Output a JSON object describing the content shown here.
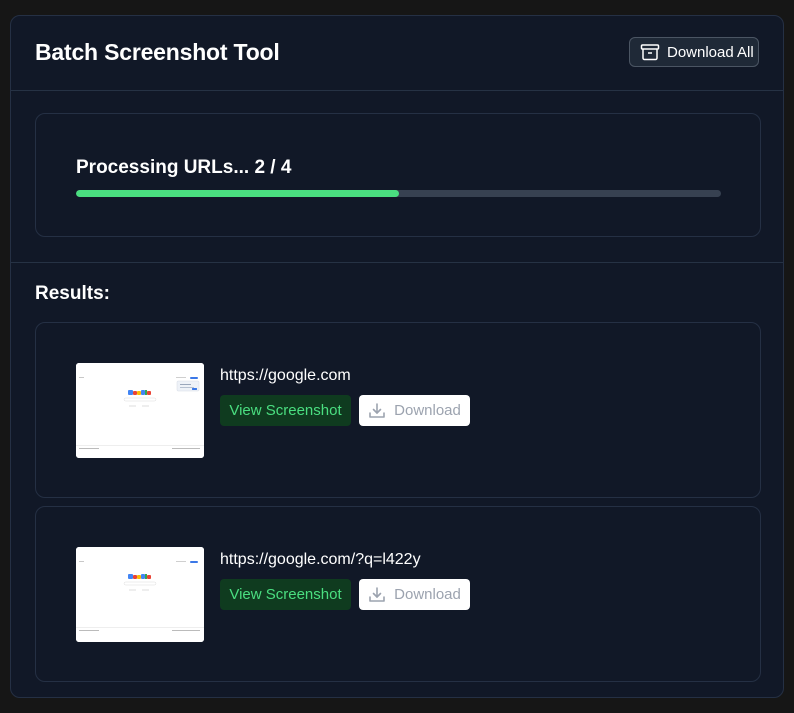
{
  "header": {
    "title": "Batch Screenshot Tool",
    "download_all_label": "Download All",
    "download_all_icon": "archive-icon"
  },
  "progress": {
    "label": "Processing URLs... 2 / 4",
    "completed": 2,
    "total": 4,
    "fraction": 0.5
  },
  "results": {
    "label": "Results:",
    "items": [
      {
        "url": "https://google.com",
        "view_label": "View Screenshot",
        "download_label": "Download",
        "download_icon": "download-icon"
      },
      {
        "url": "https://google.com/?q=l422y",
        "view_label": "View Screenshot",
        "download_label": "Download",
        "download_icon": "download-icon"
      }
    ]
  },
  "colors": {
    "background": "#111827",
    "progress_fill": "#4ade80",
    "progress_track": "#374151",
    "view_button_bg": "#0f3b1f",
    "view_button_text": "#4ade80"
  }
}
